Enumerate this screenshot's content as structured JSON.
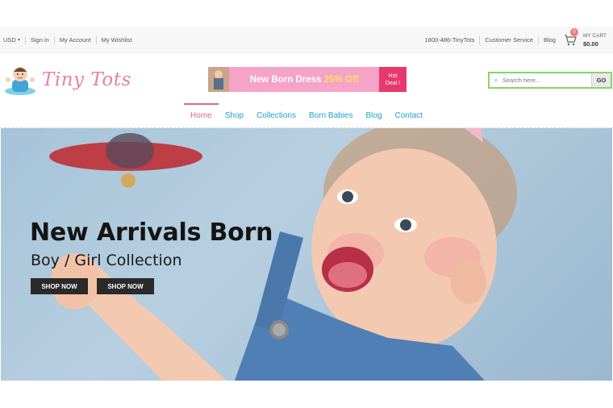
{
  "topbar": {
    "currency": "USD",
    "sign_in": "Sign in",
    "my_account": "My Account",
    "my_wishlist": "My Wishlist",
    "phone": "1800-486-TinyTots",
    "customer_service": "Customer Service",
    "blog": "Blog",
    "cart_label": "MY CART",
    "cart_amount": "$0.00",
    "cart_count": "0"
  },
  "header": {
    "logo_text": "Tiny Tots",
    "promo_text": "New Born Dress",
    "promo_pct": "25% Off",
    "promo_hot_line1": "Hot",
    "promo_hot_line2": "Deal !",
    "search_placeholder": "Search here...",
    "search_go": "GO"
  },
  "nav": {
    "items": [
      "Home",
      "Shop",
      "Collections",
      "Born Babies",
      "Blog",
      "Contact"
    ],
    "active": "Home"
  },
  "hero": {
    "title": "New Arrivals Born",
    "subtitle": "Boy / Girl Collection",
    "button1": "SHOP NOW",
    "button2": "SHOP NOW"
  },
  "colors": {
    "accent_pink": "#e6648a",
    "nav_blue": "#1f9fcf",
    "search_border": "#86d36c"
  }
}
